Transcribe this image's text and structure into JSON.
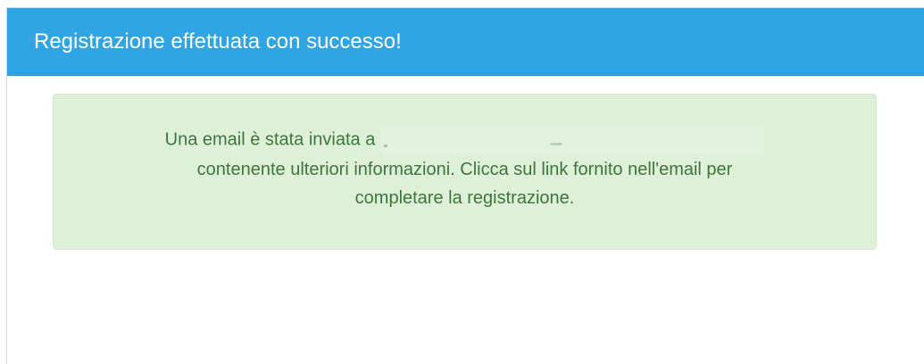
{
  "panel": {
    "title": "Registrazione effettuata con successo!"
  },
  "alert": {
    "line1": "Una email è stata inviata a",
    "line2": "contenente ulteriori informazioni. Clicca sul link fornito nell'email per",
    "line3": "completare la registrazione."
  },
  "colors": {
    "heading_bg": "#31a4e3",
    "heading_text": "#ffffff",
    "alert_bg": "#dff0d8",
    "alert_border": "#d6e9c6",
    "alert_text": "#3c763d"
  }
}
